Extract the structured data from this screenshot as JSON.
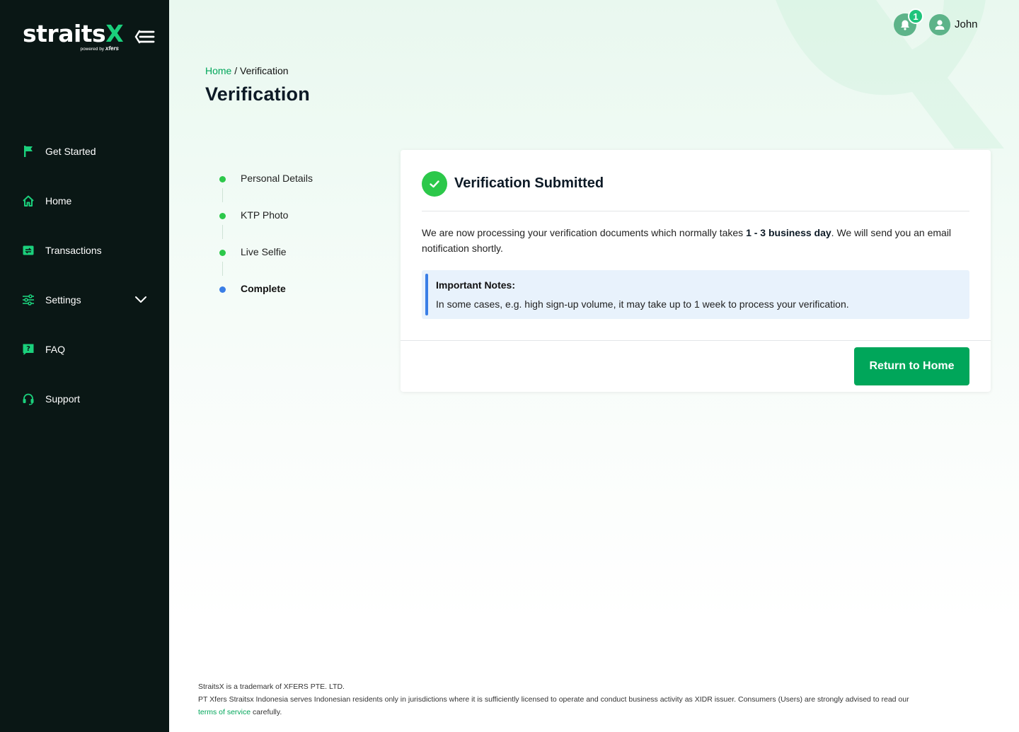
{
  "brand": {
    "name_main": "straits",
    "name_accent": "X",
    "powered_by": "powered by",
    "powered_brand": "xfers"
  },
  "sidebar": {
    "items": [
      {
        "label": "Get Started",
        "icon": "flag-icon"
      },
      {
        "label": "Home",
        "icon": "home-icon"
      },
      {
        "label": "Transactions",
        "icon": "transactions-icon"
      },
      {
        "label": "Settings",
        "icon": "sliders-icon"
      },
      {
        "label": "FAQ",
        "icon": "faq-icon"
      },
      {
        "label": "Support",
        "icon": "headset-icon"
      }
    ]
  },
  "header": {
    "notification_count": "1",
    "user_name": "John"
  },
  "breadcrumb": {
    "home": "Home",
    "separator": "/",
    "current": "Verification"
  },
  "page": {
    "title": "Verification"
  },
  "stepper": {
    "steps": [
      {
        "label": "Personal Details",
        "status": "done"
      },
      {
        "label": "KTP Photo",
        "status": "done"
      },
      {
        "label": "Live Selfie",
        "status": "done"
      },
      {
        "label": "Complete",
        "status": "current"
      }
    ]
  },
  "card": {
    "title": "Verification Submitted",
    "message_pre": "We are now processing your verification documents which normally takes ",
    "message_bold": "1 - 3 business day",
    "message_post": ". We will send you an email notification shortly.",
    "notes_title": "Important Notes:",
    "notes_body": "In some cases, e.g. high sign-up volume, it may take up to 1 week to process your verification.",
    "button": "Return to Home"
  },
  "footer": {
    "line1": "StraitsX is a trademark of XFERS PTE. LTD.",
    "line2": "PT Xfers Straitsx Indonesia serves Indonesian residents only in jurisdictions where it is sufficiently licensed to operate and conduct business activity as XIDR issuer. Consumers (Users) are strongly advised to read our",
    "tos_link": "terms of service",
    "line3_post": " carefully."
  },
  "colors": {
    "sidebar_bg": "#0a1715",
    "accent_green": "#00a65a",
    "icon_green": "#1bd07c",
    "step_blue": "#3a7ee6",
    "notes_bg": "#e8f2fc"
  }
}
